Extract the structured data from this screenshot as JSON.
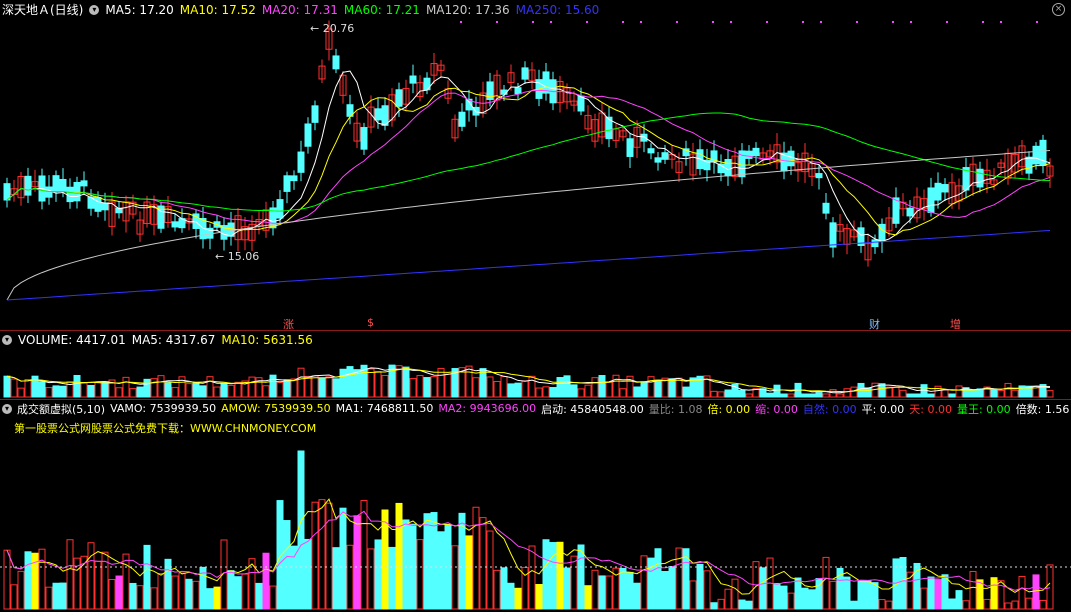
{
  "main_panel": {
    "title": "深天地Ａ(日线)",
    "ma5": "MA5: 17.20",
    "ma10": "MA10: 17.52",
    "ma20": "MA20: 17.31",
    "ma60": "MA60: 17.21",
    "ma120": "MA120: 17.36",
    "ma250": "MA250: 15.60",
    "high_label": "20.76",
    "low_label": "15.06",
    "markers": [
      "涨",
      "$",
      "财",
      "增"
    ]
  },
  "volume_panel": {
    "title": "VOLUME: 4417.01",
    "ma5": "MA5: 4317.67",
    "ma10": "MA10: 5631.56"
  },
  "indicator_panel": {
    "title": "成交额虚拟(5,10)",
    "vamo": "VAMO: 7539939.50",
    "amow": "AMOW: 7539939.50",
    "ma1": "MA1: 7468811.50",
    "ma2": "MA2: 9943696.00",
    "qidong": "启动: 45840548.00",
    "liangbi": "量比: 1.08",
    "bei": "倍: 0.00",
    "suo": "缩: 0.00",
    "ziran": "自然: 0.00",
    "ping": "平: 0.00",
    "tian": "天: 0.00",
    "liangwang": "量王: 0.00",
    "beishu": "倍数: 1.56",
    "promo": "第一股票公式网股票公式免费下载：WWW.CHNMONEY.COM"
  },
  "colors": {
    "up": "#ff3030",
    "down": "#54ffff",
    "ma5": "#ffffff",
    "ma10": "#ffff00",
    "ma20": "#ff44ff",
    "ma60": "#00ff00",
    "ma120": "#c8c8c8",
    "ma250": "#3333ff"
  }
}
